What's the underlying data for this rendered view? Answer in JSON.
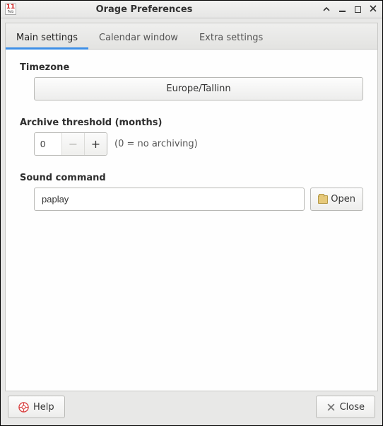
{
  "window": {
    "title": "Orage Preferences",
    "app_icon": {
      "day": "11",
      "month": "Feb"
    }
  },
  "tabs": [
    {
      "label": "Main settings",
      "active": true
    },
    {
      "label": "Calendar window",
      "active": false
    },
    {
      "label": "Extra settings",
      "active": false
    }
  ],
  "main_settings": {
    "timezone": {
      "label": "Timezone",
      "value": "Europe/Tallinn"
    },
    "archive_threshold": {
      "label": "Archive threshold (months)",
      "value": "0",
      "hint": "(0 = no archiving)"
    },
    "sound_command": {
      "label": "Sound command",
      "value": "paplay",
      "open_label": "Open"
    }
  },
  "buttons": {
    "help": "Help",
    "close": "Close"
  }
}
